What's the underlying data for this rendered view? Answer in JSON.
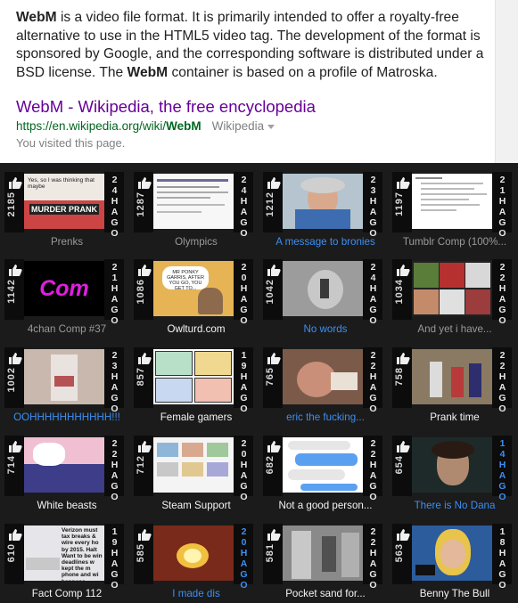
{
  "search_result": {
    "snippet_html_parts": {
      "term": "WebM",
      "part1": " is a video file format. It is primarily intended to offer a royalty-free alternative to use in the HTML5 video tag. The development of the format is sponsored by Google, and the corresponding software is distributed under a BSD license. The ",
      "term2": "WebM",
      "part2": " container is based on a profile of Matroska."
    },
    "title": "WebM - Wikipedia, the free encyclopedia",
    "url_prefix": "https://en.wikipedia.org/wiki/",
    "url_bold": "WebM",
    "source": "Wikipedia",
    "visited": "You visited this page."
  },
  "tiles": [
    {
      "votes": "2185",
      "age": "24HAGO",
      "label": "Prenks",
      "label_color": "gray",
      "age_color": "white"
    },
    {
      "votes": "1287",
      "age": "24HAGO",
      "label": "Olympics",
      "label_color": "gray",
      "age_color": "white"
    },
    {
      "votes": "1212",
      "age": "23HAGO",
      "label": "A message to bronies",
      "label_color": "blue",
      "age_color": "white"
    },
    {
      "votes": "1197",
      "age": "21HAGO",
      "label": "Tumblr Comp (100%...",
      "label_color": "gray",
      "age_color": "white"
    },
    {
      "votes": "1142",
      "age": "21HAGO",
      "label": "4chan Comp #37",
      "label_color": "gray",
      "age_color": "white"
    },
    {
      "votes": "1086",
      "age": "20HAGO",
      "label": "Owlturd.com",
      "label_color": "white",
      "age_color": "white"
    },
    {
      "votes": "1042",
      "age": "24HAGO",
      "label": "No words",
      "label_color": "blue",
      "age_color": "white"
    },
    {
      "votes": "1034",
      "age": "22HAGO",
      "label": "And yet i have...",
      "label_color": "gray",
      "age_color": "white"
    },
    {
      "votes": "1002",
      "age": "23HAGO",
      "label": "OOHHHHHHHHHHH!!!",
      "label_color": "blue",
      "age_color": "white"
    },
    {
      "votes": "857",
      "age": "19HAGO",
      "label": "Female gamers",
      "label_color": "white",
      "age_color": "white"
    },
    {
      "votes": "765",
      "age": "22HAGO",
      "label": "eric the fucking...",
      "label_color": "blue",
      "age_color": "white"
    },
    {
      "votes": "758",
      "age": "22HAGO",
      "label": "Prank time",
      "label_color": "white",
      "age_color": "white"
    },
    {
      "votes": "714",
      "age": "22HAGO",
      "label": "White beasts",
      "label_color": "white",
      "age_color": "white"
    },
    {
      "votes": "712",
      "age": "20HAGO",
      "label": "Steam Support",
      "label_color": "white",
      "age_color": "white"
    },
    {
      "votes": "682",
      "age": "22HAGO",
      "label": "Not a good person...",
      "label_color": "white",
      "age_color": "white"
    },
    {
      "votes": "654",
      "age": "14HAGO",
      "label": "There is No Dana",
      "label_color": "blue",
      "age_color": "blue"
    },
    {
      "votes": "610",
      "age": "19HAGO",
      "label": "Fact Comp 112",
      "label_color": "white",
      "age_color": "white"
    },
    {
      "votes": "585",
      "age": "20HAGO",
      "label": "I made dis",
      "label_color": "blue",
      "age_color": "blue"
    },
    {
      "votes": "581",
      "age": "22HAGO",
      "label": "Pocket sand for...",
      "label_color": "white",
      "age_color": "white"
    },
    {
      "votes": "563",
      "age": "18HAGO",
      "label": "Benny The Bull",
      "label_color": "white",
      "age_color": "white"
    }
  ],
  "thumb_text": {
    "t1_caption": "Yes, so I was thinking that maybe",
    "t1_sign": "MURDER PRANK",
    "t5_text": "Com",
    "t6_bubble": "MR PONKY GARRIS, AFTER YOU GO, YOU GET TO... ",
    "t17_text": "Verizon must tax breaks & wire every ho by 2015. Halt Want to be win deadlines w kept the m phone and wi happens"
  }
}
